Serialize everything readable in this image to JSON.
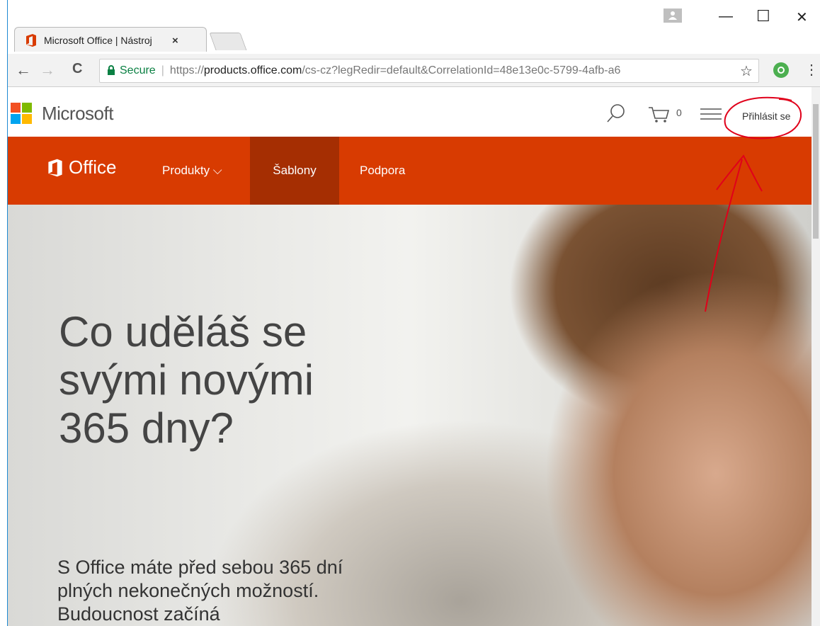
{
  "browser": {
    "tab_title": "Microsoft Office | Nástroj",
    "tab_close": "×",
    "url_secure_label": "Secure",
    "url_separator": "|",
    "url_scheme": "https://",
    "url_host": "products.office.com",
    "url_path": "/cs-cz?legRedir=default&CorrelationId=48e13e0c-5799-4afb-a6",
    "back": "←",
    "forward": "→",
    "reload": "C",
    "star": "☆",
    "menu": "⋮",
    "minimize": "—",
    "maximize": "☐",
    "close": "✕"
  },
  "header": {
    "brand": "Microsoft",
    "cart_count": "0",
    "signin_label": "Přihlásit se"
  },
  "office_nav": {
    "brand": "Office",
    "items": [
      {
        "label": "Produkty ⌵"
      },
      {
        "label": "Šablony"
      },
      {
        "label": "Podpora"
      }
    ]
  },
  "hero": {
    "title": "Co uděláš se svými novými 365 dny?",
    "subtitle": "S Office máte před sebou 365 dní plných nekonečných možností. Budoucnost začíná"
  },
  "colors": {
    "office_orange": "#d83b01",
    "active_nav": "#a52e02",
    "annotation_red": "#e0001a"
  }
}
